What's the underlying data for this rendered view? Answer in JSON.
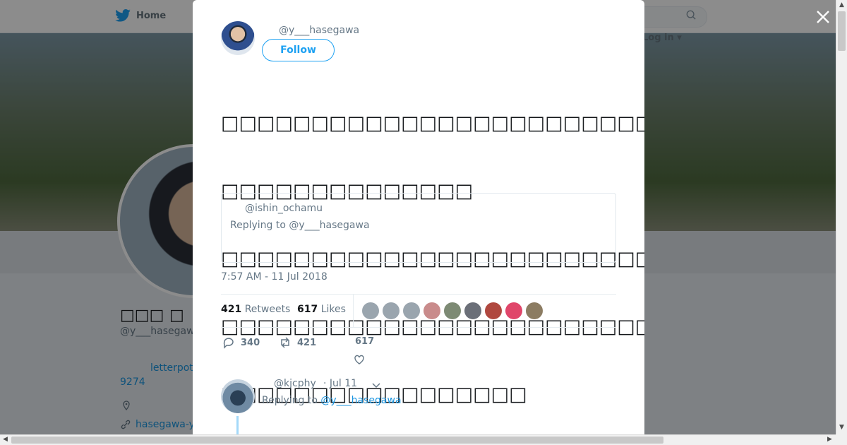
{
  "nav": {
    "home_label": "Home",
    "login_label": "Log in"
  },
  "profile": {
    "name": "□□□ □",
    "handle": "@y___hasegawa",
    "link_text": "letterpot",
    "link_number": "9274",
    "url_text": "hasegawa-y"
  },
  "tweet": {
    "author_handle": "@y___hasegawa",
    "follow_label": "Follow",
    "text_lines": [
      "□□□□□□□□□□□□□□□□□□□□□□□□□□□□□□□□□□□□□□□□□□□□□□□□□□□",
      "□□□□□□□□□□□□□□",
      "□□□□□□□□□□□□□□□□□□□□□□□□□□□□□□□□□□□□□□□",
      "□□□□□□□□□□□□□□□□□□□□□□□□□",
      "□□□□□□□□□□□□□□□□□"
    ],
    "quote": {
      "handle": "@ishin_ochamu",
      "replying": "Replying to @y___hasegawa"
    },
    "timestamp": "7:57 AM - 11 Jul 2018",
    "retweets_count": "421",
    "retweets_label": "Retweets",
    "likes_count": "617",
    "likes_label": "Likes",
    "actions": {
      "replies": "340",
      "retweets": "421",
      "likes": "617"
    }
  },
  "reply": {
    "handle": "@kjcphy",
    "date": "· Jul 11",
    "replying_prefix": "Replying to",
    "replying_handle": "@y___hasegawa"
  },
  "icons": [
    "twitter-bird-icon",
    "search-icon",
    "close-icon",
    "reply-icon",
    "retweet-icon",
    "heart-icon",
    "location-icon",
    "link-icon",
    "chevron-down-icon"
  ],
  "colors": {
    "accent": "#1da1f2",
    "link": "#1b95e0",
    "muted": "#657786"
  }
}
